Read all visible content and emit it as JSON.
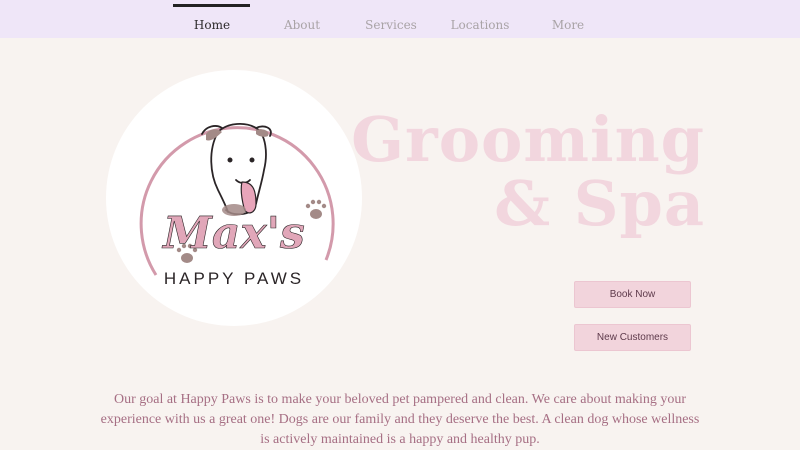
{
  "nav": {
    "items": [
      {
        "label": "Home",
        "active": true
      },
      {
        "label": "About",
        "active": false
      },
      {
        "label": "Services",
        "active": false
      },
      {
        "label": "Locations",
        "active": false
      },
      {
        "label": "More",
        "active": false
      }
    ]
  },
  "logo": {
    "script_text": "Max's",
    "tagline": "HAPPY PAWS"
  },
  "hero": {
    "title_line1": "Grooming",
    "title_line2": "& Spa"
  },
  "buttons": {
    "book_now": "Book Now",
    "new_customers": "New Customers"
  },
  "mission": {
    "text": "Our goal at Happy Paws is to make your beloved pet pampered and clean. We care about making your experience with us a great one! Dogs are our family and they deserve the best. A clean dog whose wellness is actively maintained is a happy and healthy pup."
  },
  "colors": {
    "nav_bg": "#efe6f8",
    "page_bg": "#f8f3f0",
    "accent_pink": "#e8b7c6",
    "title_pink": "#f2d6de",
    "paw_brown": "#a38a87"
  }
}
